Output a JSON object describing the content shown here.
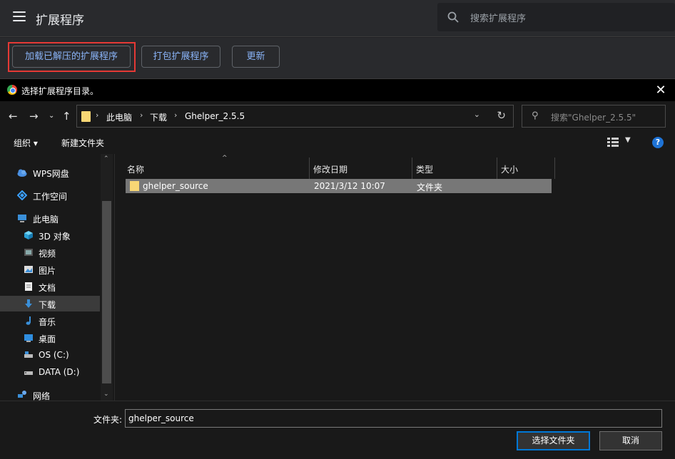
{
  "ext_page": {
    "title": "扩展程序",
    "search_placeholder": "搜索扩展程序",
    "buttons": {
      "load_unpacked": "加载已解压的扩展程序",
      "pack": "打包扩展程序",
      "update": "更新"
    },
    "highlight_color": "#e53935",
    "accent_color": "#8ab4f8"
  },
  "dialog": {
    "title": "选择扩展程序目录。",
    "breadcrumb": [
      "此电脑",
      "下载",
      "Ghelper_2.5.5"
    ],
    "search_placeholder": "搜索\"Ghelper_2.5.5\"",
    "commands": {
      "organize": "组织 ▾",
      "new_folder": "新建文件夹"
    },
    "nav_items": [
      {
        "label": "WPS网盘",
        "icon": "cloud-icon"
      },
      {
        "label": "工作空间",
        "icon": "workspace-icon"
      },
      {
        "label": "此电脑",
        "icon": "computer-icon"
      },
      {
        "label": "3D 对象",
        "icon": "cube-icon"
      },
      {
        "label": "视频",
        "icon": "video-icon"
      },
      {
        "label": "图片",
        "icon": "picture-icon"
      },
      {
        "label": "文档",
        "icon": "document-icon"
      },
      {
        "label": "下载",
        "icon": "download-icon",
        "selected": true
      },
      {
        "label": "音乐",
        "icon": "music-icon"
      },
      {
        "label": "桌面",
        "icon": "desktop-icon"
      },
      {
        "label": "OS (C:)",
        "icon": "drive-icon"
      },
      {
        "label": "DATA (D:)",
        "icon": "drive-icon"
      },
      {
        "label": "网络",
        "icon": "network-icon"
      }
    ],
    "columns": [
      "名称",
      "修改日期",
      "类型",
      "大小"
    ],
    "files": [
      {
        "name": "ghelper_source",
        "modified": "2021/3/12 10:07",
        "type": "文件夹",
        "size": ""
      }
    ],
    "filename_label": "文件夹:",
    "filename_value": "ghelper_source",
    "select_button": "选择文件夹",
    "cancel_button": "取消"
  }
}
